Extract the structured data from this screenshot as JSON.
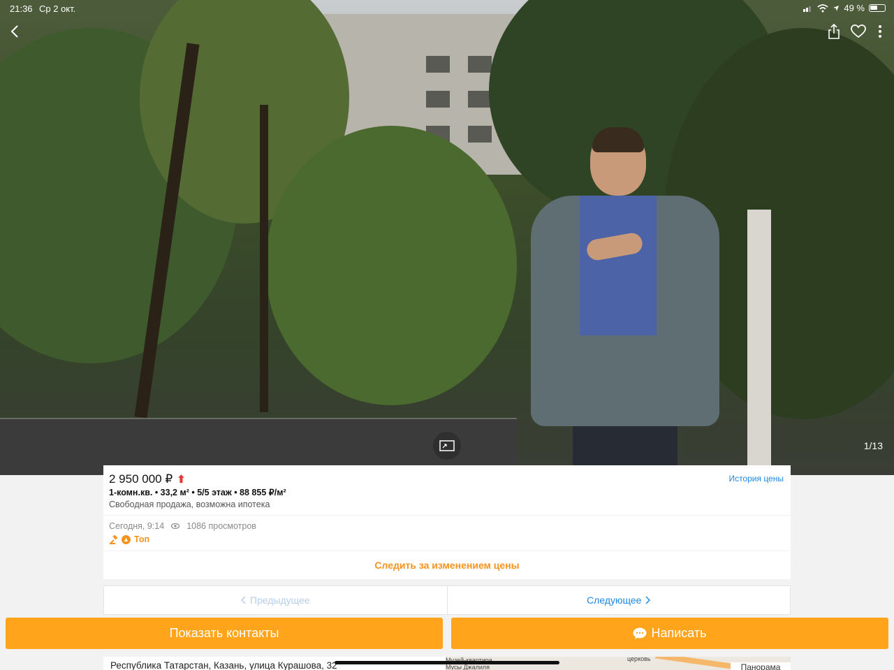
{
  "status": {
    "time": "21:36",
    "date": "Ср 2 окт.",
    "battery": "49 %"
  },
  "gallery": {
    "counter": "1/13"
  },
  "listing": {
    "price": "2 950 000 ₽",
    "price_trend_icon": "arrow-up-icon",
    "history_link": "История цены",
    "params": "1-комн.кв.  •  33,2 м²  •  5/5 этаж  •  88 855 ₽/м²",
    "sale_terms": "Свободная продажа, возможна ипотека",
    "posted": "Сегодня, 9:14",
    "views": "1086 просмотров",
    "top_badge": "Топ"
  },
  "actions": {
    "follow_price": "Следить за изменением цены",
    "prev": "Предыдущее",
    "next": "Следующее",
    "show_contacts": "Показать контакты",
    "write": "Написать"
  },
  "location": {
    "address": "Республика Татарстан, Казань, улица Курашова, 32",
    "panorama": "Панорама",
    "map_label_1": "Музей-квартира",
    "map_label_2": "Мусы Джалиля",
    "map_label_3": "церковь"
  },
  "colors": {
    "accent": "#ffa41b",
    "link": "#1e88e5",
    "price_up": "#e53935"
  }
}
